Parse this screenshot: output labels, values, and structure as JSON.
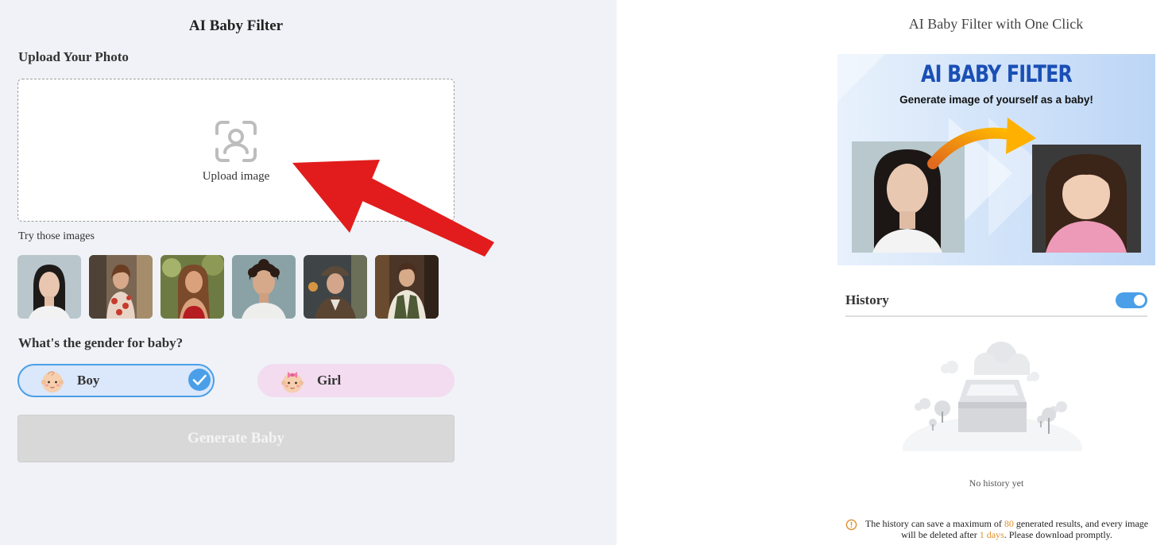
{
  "left_panel": {
    "app_title": "AI Baby Filter",
    "upload_label": "Upload Your Photo",
    "dropzone_text": "Upload image",
    "try_label": "Try those images",
    "sample_count_icons": [
      "portrait-asian-woman",
      "portrait-woman-floral-dress",
      "portrait-woman-red-top",
      "portrait-curly-hair-man",
      "portrait-man-cap",
      "portrait-man-vest"
    ],
    "gender_question": "What's the gender for baby?",
    "gender_options": [
      {
        "label": "Boy",
        "selected": true
      },
      {
        "label": "Girl",
        "selected": false
      }
    ],
    "generate_label": "Generate Baby"
  },
  "right_panel": {
    "title": "AI Baby Filter with One Click",
    "banner": {
      "title": "AI BABY FILTER",
      "subtitle": "Generate image of yourself as a baby!"
    },
    "history_title": "History",
    "history_toggle_on": true,
    "empty_text": "No history yet",
    "notice": {
      "part1": "The history can save a maximum of ",
      "max_results": "80",
      "part2": " generated results, and every image will be deleted after ",
      "days": "1 days",
      "part3": ". Please download promptly."
    }
  },
  "colors": {
    "accent": "#4a9fe8",
    "left_bg": "#f0f2f7",
    "boy_bg": "#dbe7fa",
    "girl_bg": "#f3dcef",
    "generate_disabled": "#d8d8d8",
    "notice_highlight": "#e0902f",
    "banner_title": "#1a4fb5"
  }
}
